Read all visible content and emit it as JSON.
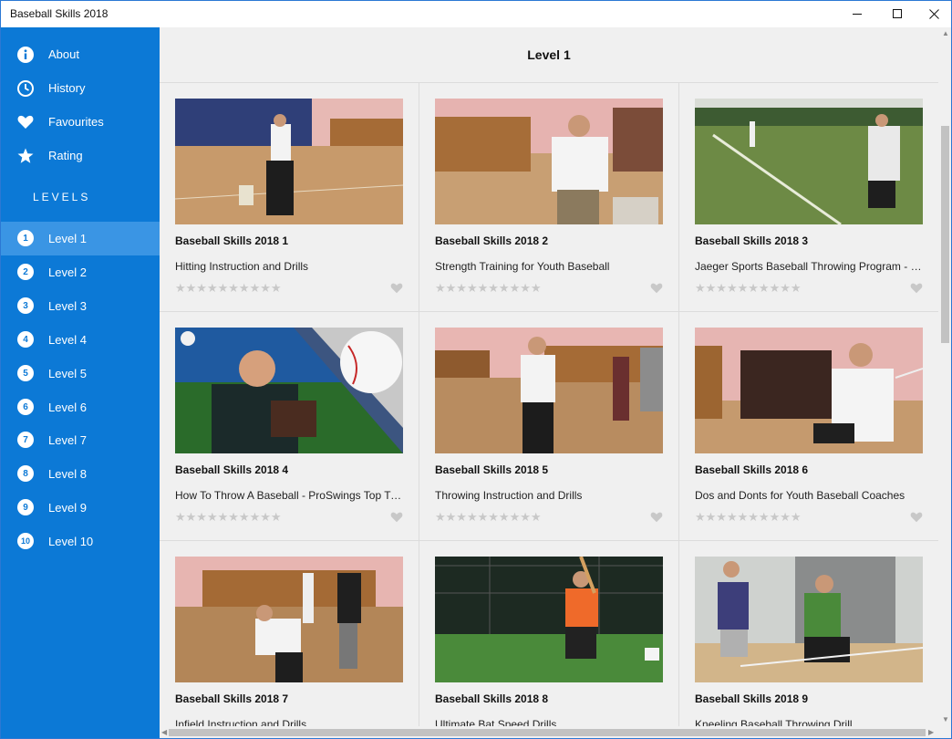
{
  "window": {
    "title": "Baseball Skills 2018"
  },
  "nav": [
    {
      "label": "About",
      "icon": "info-icon"
    },
    {
      "label": "History",
      "icon": "clock-icon"
    },
    {
      "label": "Favourites",
      "icon": "heart-icon"
    },
    {
      "label": "Rating",
      "icon": "star-icon"
    }
  ],
  "levels_heading": "LEVELS",
  "levels": [
    {
      "num": "1",
      "label": "Level 1"
    },
    {
      "num": "2",
      "label": "Level 2"
    },
    {
      "num": "3",
      "label": "Level 3"
    },
    {
      "num": "4",
      "label": "Level 4"
    },
    {
      "num": "5",
      "label": "Level 5"
    },
    {
      "num": "6",
      "label": "Level 6"
    },
    {
      "num": "7",
      "label": "Level 7"
    },
    {
      "num": "8",
      "label": "Level 8"
    },
    {
      "num": "9",
      "label": "Level 9"
    },
    {
      "num": "10",
      "label": "Level 10"
    }
  ],
  "active_level": "Level 1",
  "page_title": "Level 1",
  "stars": "★★★★★★★★★★",
  "videos": [
    {
      "title": "Baseball Skills 2018 1",
      "subtitle": "Hitting Instruction and Drills"
    },
    {
      "title": "Baseball Skills 2018 2",
      "subtitle": "Strength Training for Youth Baseball"
    },
    {
      "title": "Baseball Skills 2018 3",
      "subtitle": "Jaeger Sports Baseball Throwing Program - Long Toss"
    },
    {
      "title": "Baseball Skills 2018 4",
      "subtitle": "How To Throw A Baseball - ProSwings Top Tips"
    },
    {
      "title": "Baseball Skills 2018 5",
      "subtitle": "Throwing Instruction and Drills"
    },
    {
      "title": "Baseball Skills 2018 6",
      "subtitle": "Dos and Donts for Youth Baseball Coaches"
    },
    {
      "title": "Baseball Skills 2018 7",
      "subtitle": "Infield Instruction and Drills"
    },
    {
      "title": "Baseball Skills 2018 8",
      "subtitle": "Ultimate Bat Speed Drills"
    },
    {
      "title": "Baseball Skills 2018 9",
      "subtitle": "Kneeling Baseball Throwing Drill"
    }
  ],
  "colors": {
    "sidebar": "#0c79d6",
    "active_level": "#3a95e4",
    "content_bg": "#f0f0f0"
  }
}
